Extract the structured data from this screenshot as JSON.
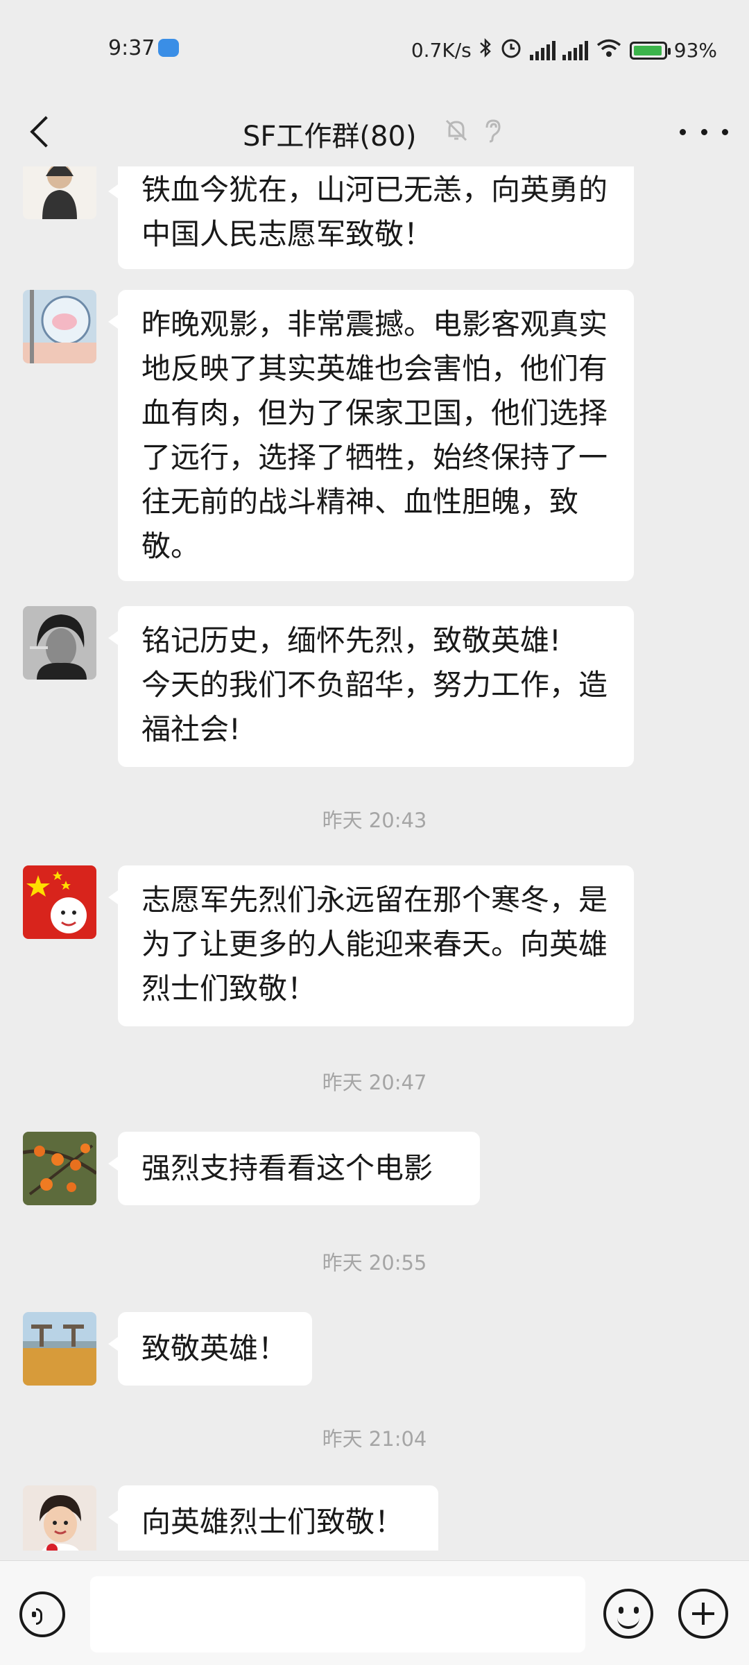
{
  "status_bar": {
    "time": "9:37",
    "network_speed": "0.7K/s",
    "battery": "93%",
    "icons": [
      "cloud-icon",
      "bluetooth-icon",
      "alarm-icon",
      "signal-hd-icon",
      "signal-hd-icon",
      "wifi-icon",
      "battery-charging-icon"
    ]
  },
  "header": {
    "title": "SF工作群(80)",
    "icons": [
      "back-icon",
      "mute-bell-icon",
      "earpiece-icon",
      "more-icon"
    ]
  },
  "messages": [
    {
      "type": "text",
      "avatar": "avatar-cartoon-man",
      "text": "铁血今犹在，山河已无恙，向英勇的中国人民志愿军致敬！"
    },
    {
      "type": "text",
      "avatar": "avatar-pink-cartoon",
      "text": "昨晚观影，非常震撼。电影客观真实地反映了其实英雄也会害怕，他们有血有肉，但为了保家卫国，他们选择了远行，选择了牺牲，始终保持了一往无前的战斗精神、血性胆魄，致敬。"
    },
    {
      "type": "text",
      "avatar": "avatar-bw-portrait",
      "text": "铭记历史，缅怀先烈，致敬英雄!\n今天的我们不负韶华，努力工作，造福社会!"
    },
    {
      "type": "time",
      "text": "昨天 20:43"
    },
    {
      "type": "text",
      "avatar": "avatar-flag",
      "text": "志愿军先烈们永远留在那个寒冬，是为了让更多的人能迎来春天。向英雄烈士们致敬！"
    },
    {
      "type": "time",
      "text": "昨天 20:47"
    },
    {
      "type": "text",
      "avatar": "avatar-persimmons",
      "text": "强烈支持看看这个电影"
    },
    {
      "type": "time",
      "text": "昨天 20:55"
    },
    {
      "type": "text",
      "avatar": "avatar-field",
      "text": "致敬英雄！"
    },
    {
      "type": "time",
      "text": "昨天 21:04"
    },
    {
      "type": "text",
      "avatar": "avatar-child",
      "text": "向英雄烈士们致敬！"
    }
  ],
  "input_bar": {
    "placeholder": "",
    "icons": [
      "voice-icon",
      "emoji-icon",
      "plus-icon"
    ]
  },
  "colors": {
    "background": "#ededed",
    "bubble": "#ffffff",
    "timestamp": "#a5a5a5",
    "text": "#191919"
  }
}
